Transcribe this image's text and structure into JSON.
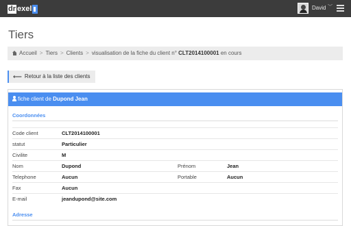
{
  "topbar": {
    "logo_first": "dr",
    "logo_rest": "exel",
    "user_name": "David",
    "user_caret": "﹀"
  },
  "page": {
    "title": "Tiers"
  },
  "breadcrumb": {
    "home": "Accueil",
    "tiers": "Tiers",
    "clients": "Clients",
    "current_prefix": "visualisation de la fiche du client n°",
    "client_code": "CLT2014100001",
    "current_suffix": "en cours"
  },
  "back_button": {
    "arrow": "⟵",
    "label": "Retour à la liste des clients"
  },
  "panel": {
    "header_prefix": "fiche client de",
    "client_name": "Dupond Jean",
    "section_coordonnees": "Coordonnées",
    "section_adresse": "Adresse",
    "fields": {
      "code_client": {
        "label": "Code client",
        "value": "CLT2014100001"
      },
      "statut": {
        "label": "statut",
        "value": "Particulier"
      },
      "civilite": {
        "label": "Civilite",
        "value": "M"
      },
      "nom": {
        "label": "Nom",
        "value": "Dupond"
      },
      "prenom": {
        "label": "Prénom",
        "value": "Jean"
      },
      "telephone": {
        "label": "Telephone",
        "value": "Aucun"
      },
      "portable": {
        "label": "Portable",
        "value": "Aucun"
      },
      "fax": {
        "label": "Fax",
        "value": "Aucun"
      },
      "email": {
        "label": "E-mail",
        "value": "jeandupond@site.com"
      }
    }
  },
  "colors": {
    "topbar": "#3c3c3c",
    "accent": "#4a8ef0",
    "breadcrumb_bg": "#ececec"
  }
}
